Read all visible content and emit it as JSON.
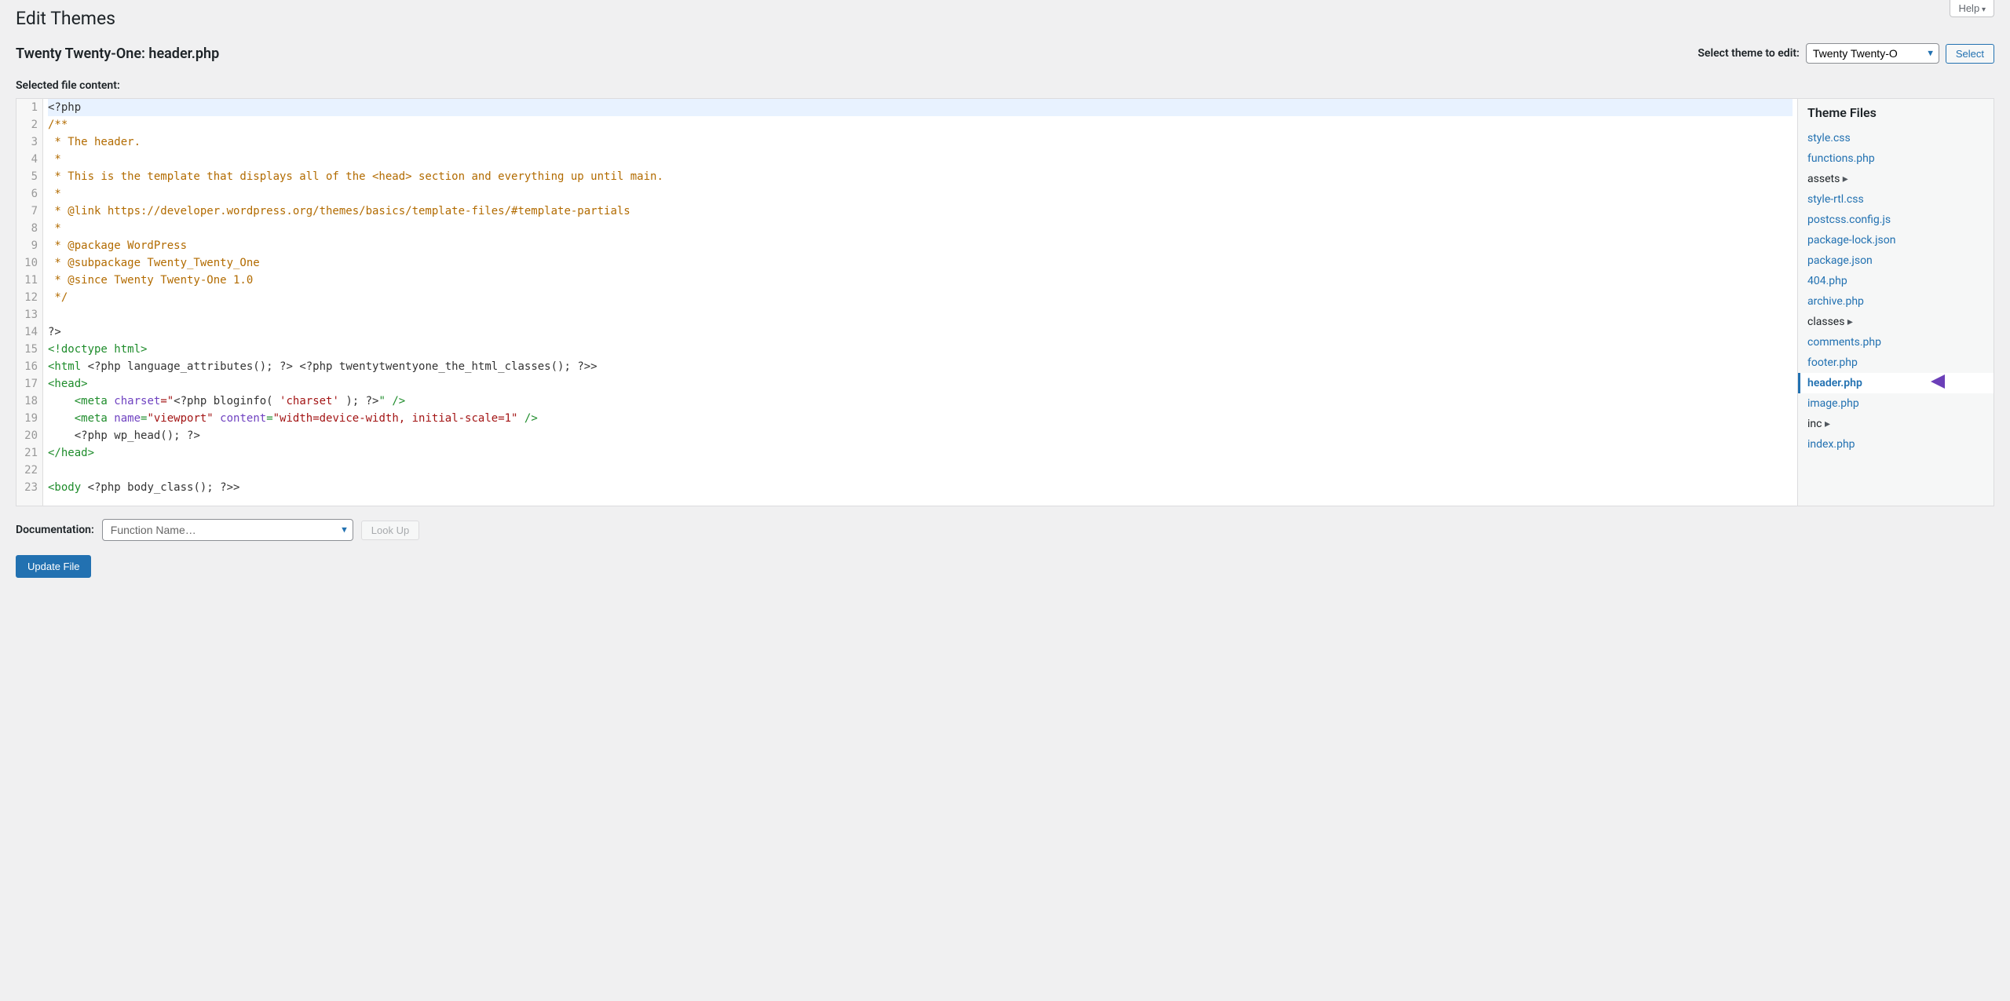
{
  "help_label": "Help",
  "page_title": "Edit Themes",
  "sub_heading": "Twenty Twenty-One: header.php",
  "theme_select": {
    "label": "Select theme to edit:",
    "value": "Twenty Twenty-O",
    "button": "Select"
  },
  "selected_file_label": "Selected file content:",
  "docs": {
    "label": "Documentation:",
    "placeholder": "Function Name…",
    "lookup": "Look Up"
  },
  "update_button": "Update File",
  "files_heading": "Theme Files",
  "files": [
    {
      "name": "style.css",
      "type": "file"
    },
    {
      "name": "functions.php",
      "type": "file"
    },
    {
      "name": "assets",
      "type": "folder"
    },
    {
      "name": "style-rtl.css",
      "type": "file"
    },
    {
      "name": "postcss.config.js",
      "type": "file"
    },
    {
      "name": "package-lock.json",
      "type": "file"
    },
    {
      "name": "package.json",
      "type": "file"
    },
    {
      "name": "404.php",
      "type": "file"
    },
    {
      "name": "archive.php",
      "type": "file"
    },
    {
      "name": "classes",
      "type": "folder"
    },
    {
      "name": "comments.php",
      "type": "file"
    },
    {
      "name": "footer.php",
      "type": "file"
    },
    {
      "name": "header.php",
      "type": "file",
      "active": true
    },
    {
      "name": "image.php",
      "type": "file"
    },
    {
      "name": "inc",
      "type": "folder"
    },
    {
      "name": "index.php",
      "type": "file"
    }
  ],
  "code": [
    {
      "n": 1,
      "hl": true,
      "tokens": [
        {
          "t": "<?php",
          "c": "c-php"
        }
      ]
    },
    {
      "n": 2,
      "tokens": [
        {
          "t": "/**",
          "c": "c-comment"
        }
      ]
    },
    {
      "n": 3,
      "tokens": [
        {
          "t": " * The header.",
          "c": "c-comment"
        }
      ]
    },
    {
      "n": 4,
      "tokens": [
        {
          "t": " *",
          "c": "c-comment"
        }
      ]
    },
    {
      "n": 5,
      "tokens": [
        {
          "t": " * This is the template that displays all of the <head> section and everything up until main.",
          "c": "c-comment"
        }
      ]
    },
    {
      "n": 6,
      "tokens": [
        {
          "t": " *",
          "c": "c-comment"
        }
      ]
    },
    {
      "n": 7,
      "tokens": [
        {
          "t": " * @link https://developer.wordpress.org/themes/basics/template-files/#template-partials",
          "c": "c-comment"
        }
      ]
    },
    {
      "n": 8,
      "tokens": [
        {
          "t": " *",
          "c": "c-comment"
        }
      ]
    },
    {
      "n": 9,
      "tokens": [
        {
          "t": " * @package WordPress",
          "c": "c-comment"
        }
      ]
    },
    {
      "n": 10,
      "tokens": [
        {
          "t": " * @subpackage Twenty_Twenty_One",
          "c": "c-comment"
        }
      ]
    },
    {
      "n": 11,
      "tokens": [
        {
          "t": " * @since Twenty Twenty-One 1.0",
          "c": "c-comment"
        }
      ]
    },
    {
      "n": 12,
      "tokens": [
        {
          "t": " */",
          "c": "c-comment"
        }
      ]
    },
    {
      "n": 13,
      "tokens": [
        {
          "t": "",
          "c": "c-default"
        }
      ]
    },
    {
      "n": 14,
      "tokens": [
        {
          "t": "?>",
          "c": "c-php"
        }
      ]
    },
    {
      "n": 15,
      "tokens": [
        {
          "t": "<!doctype html>",
          "c": "c-tag"
        }
      ]
    },
    {
      "n": 16,
      "tokens": [
        {
          "t": "<html ",
          "c": "c-tag"
        },
        {
          "t": "<?php ",
          "c": "c-php"
        },
        {
          "t": "language_attributes(); ",
          "c": "c-default"
        },
        {
          "t": "?> <?php ",
          "c": "c-php"
        },
        {
          "t": "twentytwentyone_the_html_classes(); ",
          "c": "c-default"
        },
        {
          "t": "?>>",
          "c": "c-php"
        }
      ]
    },
    {
      "n": 17,
      "tokens": [
        {
          "t": "<head>",
          "c": "c-tag"
        }
      ]
    },
    {
      "n": 18,
      "tokens": [
        {
          "t": "    <meta ",
          "c": "c-tag"
        },
        {
          "t": "charset",
          "c": "c-attr"
        },
        {
          "t": "=\"",
          "c": "c-str"
        },
        {
          "t": "<?php ",
          "c": "c-php"
        },
        {
          "t": "bloginfo( ",
          "c": "c-default"
        },
        {
          "t": "'charset'",
          "c": "c-str"
        },
        {
          "t": " ); ",
          "c": "c-default"
        },
        {
          "t": "?>",
          "c": "c-php"
        },
        {
          "t": "\" />",
          "c": "c-tag"
        }
      ]
    },
    {
      "n": 19,
      "tokens": [
        {
          "t": "    <meta ",
          "c": "c-tag"
        },
        {
          "t": "name",
          "c": "c-attr"
        },
        {
          "t": "=",
          "c": "c-tag"
        },
        {
          "t": "\"viewport\"",
          "c": "c-str"
        },
        {
          "t": " content",
          "c": "c-attr"
        },
        {
          "t": "=",
          "c": "c-tag"
        },
        {
          "t": "\"width=device-width, initial-scale=1\"",
          "c": "c-str"
        },
        {
          "t": " />",
          "c": "c-tag"
        }
      ]
    },
    {
      "n": 20,
      "tokens": [
        {
          "t": "    <?php ",
          "c": "c-php"
        },
        {
          "t": "wp_head(); ",
          "c": "c-default"
        },
        {
          "t": "?>",
          "c": "c-php"
        }
      ]
    },
    {
      "n": 21,
      "tokens": [
        {
          "t": "</head>",
          "c": "c-tag"
        }
      ]
    },
    {
      "n": 22,
      "tokens": [
        {
          "t": "",
          "c": "c-default"
        }
      ]
    },
    {
      "n": 23,
      "tokens": [
        {
          "t": "<body ",
          "c": "c-tag"
        },
        {
          "t": "<?php ",
          "c": "c-php"
        },
        {
          "t": "body_class(); ",
          "c": "c-default"
        },
        {
          "t": "?>>",
          "c": "c-php"
        }
      ]
    }
  ]
}
